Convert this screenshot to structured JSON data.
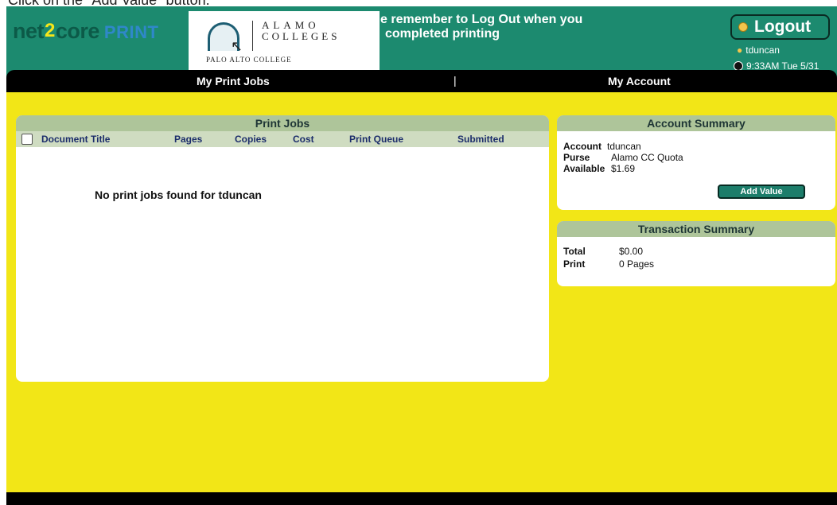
{
  "caption": "Click on the \"Add Value\" button.",
  "header": {
    "logo": {
      "prefix": "net",
      "two": "2",
      "core": "core",
      "print": "PRINT"
    },
    "college": {
      "line1": "ALAMO",
      "line2": "COLLEGES",
      "line3": "PALO ALTO COLLEGE"
    },
    "notice_line1": "e remember to Log Out when you",
    "notice_line2": "completed printing",
    "logout_label": "Logout",
    "user": "tduncan",
    "clock": "9:33AM Tue 5/31"
  },
  "nav": {
    "my_print_jobs": "My Print Jobs",
    "separator": "|",
    "my_account": "My Account"
  },
  "print_jobs": {
    "title": "Print Jobs",
    "columns": [
      "Document Title",
      "Pages",
      "Copies",
      "Cost",
      "Print Queue",
      "Submitted"
    ],
    "empty_message": "No print jobs found for tduncan"
  },
  "account_summary": {
    "title": "Account Summary",
    "account_label": "Account",
    "account_value": "tduncan",
    "purse_label": "Purse",
    "purse_value": "Alamo CC Quota",
    "available_label": "Available",
    "available_value": "$1.69",
    "add_value_button": "Add Value"
  },
  "transaction_summary": {
    "title": "Transaction Summary",
    "total_label": "Total",
    "total_value": "$0.00",
    "print_label": "Print",
    "print_value": "0 Pages"
  },
  "colors": {
    "header_bg": "#1c8a6f",
    "content_bg": "#f2e617",
    "panel_head": "#aec59a"
  }
}
